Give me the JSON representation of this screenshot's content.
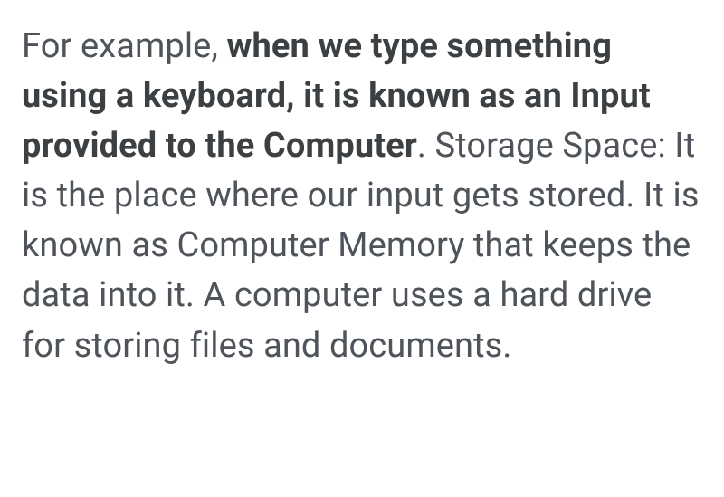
{
  "paragraph": {
    "lead": "For example, ",
    "bold": "when we type something using a keyboard, it is known as an Input provided to the Computer",
    "rest": ". Storage Space: It is the place where our input gets stored. It is known as Computer Memory that keeps the data into it. A computer uses a hard drive for storing files and documents."
  }
}
